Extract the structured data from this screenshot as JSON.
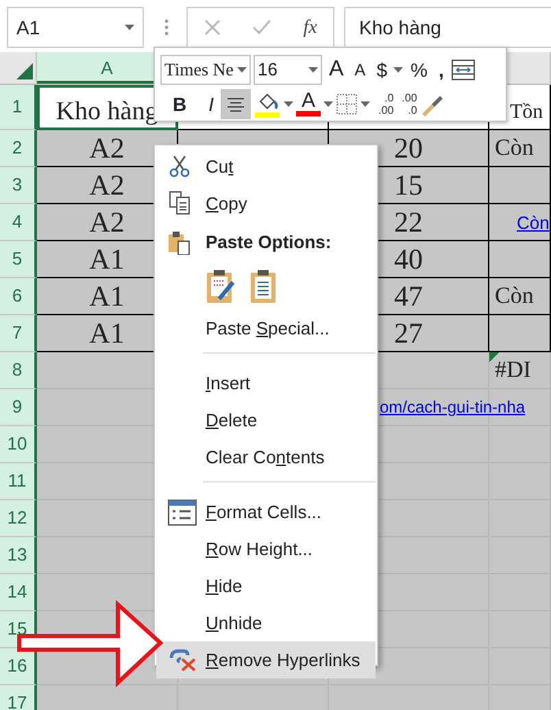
{
  "formula_bar": {
    "name_box": "A1",
    "function_label": "fx",
    "formula": "Kho hàng"
  },
  "column_headers": [
    {
      "label": "A",
      "selected": true
    }
  ],
  "rows": [
    {
      "header": "1",
      "selected": true,
      "highlighted": false,
      "bordered": true,
      "cells": [
        {
          "text": "Kho hàng"
        },
        null,
        null,
        {
          "text": "Tồn"
        }
      ]
    },
    {
      "header": "2",
      "selected": true,
      "highlighted": true,
      "bordered": true,
      "cells": [
        {
          "text": "A2"
        },
        null,
        {
          "text": "20"
        },
        {
          "text": "Còn"
        }
      ]
    },
    {
      "header": "3",
      "selected": true,
      "highlighted": true,
      "bordered": true,
      "cells": [
        {
          "text": "A2"
        },
        null,
        {
          "text": "15"
        },
        null
      ]
    },
    {
      "header": "4",
      "selected": true,
      "highlighted": true,
      "bordered": true,
      "cells": [
        {
          "text": "A2"
        },
        null,
        {
          "text": "22"
        },
        {
          "text": "Còn",
          "kind": "link"
        }
      ]
    },
    {
      "header": "5",
      "selected": true,
      "highlighted": true,
      "bordered": true,
      "cells": [
        {
          "text": "A1"
        },
        null,
        {
          "text": "40"
        },
        null
      ]
    },
    {
      "header": "6",
      "selected": true,
      "highlighted": true,
      "bordered": true,
      "cells": [
        {
          "text": "A1"
        },
        null,
        {
          "text": "47"
        },
        {
          "text": "Còn"
        }
      ]
    },
    {
      "header": "7",
      "selected": true,
      "highlighted": true,
      "bordered": true,
      "cells": [
        {
          "text": "A1"
        },
        null,
        {
          "text": "27"
        },
        null
      ]
    },
    {
      "header": "8",
      "selected": true,
      "highlighted": true,
      "bordered": false,
      "cells": [
        null,
        null,
        null,
        {
          "text": "#DI",
          "error_flag": true
        }
      ]
    },
    {
      "header": "9",
      "selected": true,
      "highlighted": true,
      "bordered": false,
      "cells": [
        null,
        null,
        {
          "text": "om/cach-gui-tin-nha",
          "kind": "overflow-link"
        },
        null
      ]
    },
    {
      "header": "10",
      "selected": true,
      "highlighted": true,
      "bordered": false,
      "cells": [
        null,
        null,
        null,
        null
      ]
    },
    {
      "header": "11",
      "selected": true,
      "highlighted": true,
      "bordered": false,
      "cells": [
        null,
        null,
        null,
        null
      ]
    },
    {
      "header": "12",
      "selected": true,
      "highlighted": true,
      "bordered": false,
      "cells": [
        null,
        null,
        null,
        null
      ]
    },
    {
      "header": "13",
      "selected": true,
      "highlighted": true,
      "bordered": false,
      "cells": [
        null,
        null,
        null,
        null
      ]
    },
    {
      "header": "14",
      "selected": true,
      "highlighted": true,
      "bordered": false,
      "cells": [
        null,
        null,
        null,
        null
      ]
    },
    {
      "header": "15",
      "selected": true,
      "highlighted": true,
      "bordered": false,
      "cells": [
        null,
        null,
        null,
        null
      ]
    },
    {
      "header": "16",
      "selected": true,
      "highlighted": true,
      "bordered": false,
      "cells": [
        null,
        null,
        null,
        null
      ]
    },
    {
      "header": "17",
      "selected": true,
      "highlighted": true,
      "bordered": false,
      "cells": [
        null,
        null,
        null,
        null
      ]
    }
  ],
  "mini_toolbar": {
    "font_name": "Times Ne",
    "font_size": "16",
    "grow_font": "A",
    "shrink_font": "A",
    "currency": "$",
    "percent": "%",
    "comma": ",",
    "bold": {
      "label": "B",
      "selected": false
    },
    "italic": {
      "label": "I",
      "selected": false
    },
    "align_center": {
      "selected": true
    },
    "fill_color": {
      "color": "#ffff00"
    },
    "font_color": {
      "label": "A",
      "color": "#ff0000"
    },
    "increase_decimal": [
      ".0",
      ".00"
    ],
    "decrease_decimal": [
      ".00",
      ".0"
    ]
  },
  "context_menu": [
    {
      "kind": "item",
      "before": "Cu",
      "key": "t",
      "selected": false
    },
    {
      "kind": "item",
      "key": "C",
      "after": "opy",
      "selected": false
    },
    {
      "kind": "header",
      "label": "Paste Options:"
    },
    {
      "kind": "paste-icons"
    },
    {
      "kind": "item",
      "before": "Paste ",
      "key": "S",
      "after": "pecial...",
      "selected": false
    },
    {
      "kind": "separator"
    },
    {
      "kind": "item",
      "key": "I",
      "after": "nsert",
      "selected": false
    },
    {
      "kind": "item",
      "key": "D",
      "after": "elete",
      "selected": false
    },
    {
      "kind": "item",
      "before": "Clear Co",
      "key": "n",
      "after": "tents",
      "selected": false
    },
    {
      "kind": "separator"
    },
    {
      "kind": "item",
      "key": "F",
      "after": "ormat Cells...",
      "selected": false
    },
    {
      "kind": "item",
      "key": "R",
      "after": "ow Height...",
      "selected": false
    },
    {
      "kind": "item",
      "key": "H",
      "after": "ide",
      "selected": false
    },
    {
      "kind": "item",
      "key": "U",
      "after": "nhide",
      "selected": false
    },
    {
      "kind": "item",
      "key": "R",
      "after": "emove Hyperlinks",
      "selected": true
    }
  ]
}
